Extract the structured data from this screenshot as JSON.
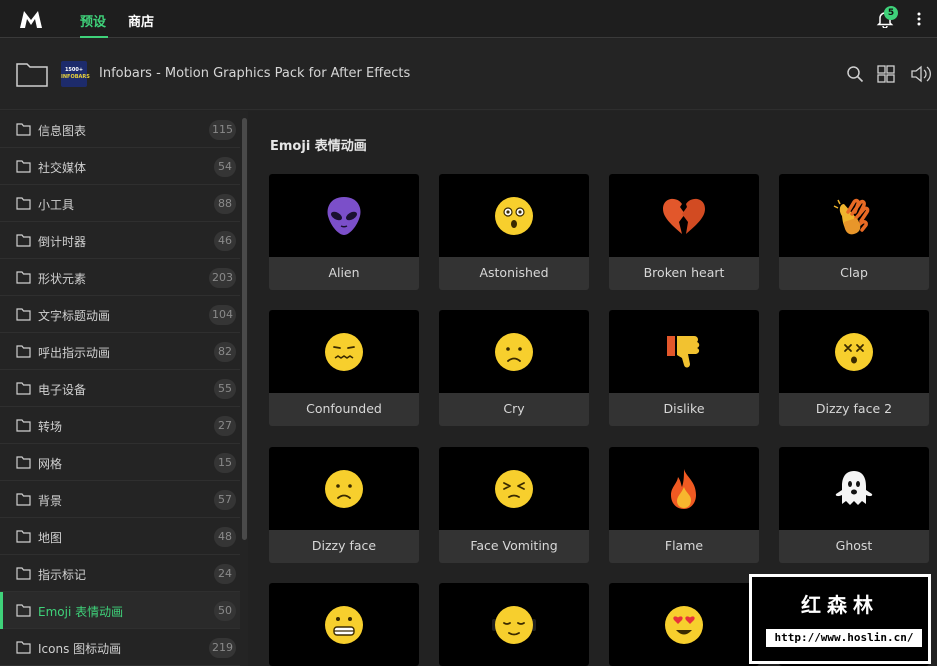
{
  "nav": {
    "tabs": [
      {
        "label": "预设"
      },
      {
        "label": "商店"
      }
    ],
    "notification_count": "5"
  },
  "pack": {
    "title": "Infobars - Motion Graphics Pack for After Effects",
    "thumb_line1": "1500+",
    "thumb_line2": "INFOBARS"
  },
  "sidebar": {
    "items": [
      {
        "label": "信息图表",
        "count": "115"
      },
      {
        "label": "社交媒体",
        "count": "54"
      },
      {
        "label": "小工具",
        "count": "88"
      },
      {
        "label": "倒计时器",
        "count": "46"
      },
      {
        "label": "形状元素",
        "count": "203"
      },
      {
        "label": "文字标题动画",
        "count": "104"
      },
      {
        "label": "呼出指示动画",
        "count": "82"
      },
      {
        "label": "电子设备",
        "count": "55"
      },
      {
        "label": "转场",
        "count": "27"
      },
      {
        "label": "网格",
        "count": "15"
      },
      {
        "label": "背景",
        "count": "57"
      },
      {
        "label": "地图",
        "count": "48"
      },
      {
        "label": "指示标记",
        "count": "24"
      },
      {
        "label": "Emoji 表情动画",
        "count": "50"
      },
      {
        "label": "Icons 图标动画",
        "count": "219"
      }
    ]
  },
  "main": {
    "section_title": "Emoji 表情动画",
    "cards": [
      {
        "label": "Alien",
        "icon": "alien-icon"
      },
      {
        "label": "Astonished",
        "icon": "astonished-face-icon"
      },
      {
        "label": "Broken heart",
        "icon": "broken-heart-icon"
      },
      {
        "label": "Clap",
        "icon": "clapping-hands-icon"
      },
      {
        "label": "Confounded",
        "icon": "confounded-face-icon"
      },
      {
        "label": "Cry",
        "icon": "crying-face-icon"
      },
      {
        "label": "Dislike",
        "icon": "thumbs-down-icon"
      },
      {
        "label": "Dizzy face 2",
        "icon": "dizzy-face-icon"
      },
      {
        "label": "Dizzy face",
        "icon": "frowning-face-icon"
      },
      {
        "label": "Face Vomiting",
        "icon": "squinting-face-icon"
      },
      {
        "label": "Flame",
        "icon": "flame-icon"
      },
      {
        "label": "Ghost",
        "icon": "ghost-icon"
      },
      {
        "label": "",
        "icon": "grimacing-face-icon"
      },
      {
        "label": "",
        "icon": "headphones-face-icon"
      },
      {
        "label": "",
        "icon": "heart-eyes-face-icon"
      },
      {
        "label": "",
        "icon": "red-face-icon"
      }
    ]
  },
  "watermark": {
    "title": "红森林",
    "url": "http://www.hoslin.cn/"
  },
  "colors": {
    "accent": "#3fd27a",
    "background": "#232323",
    "card": "#333333"
  }
}
